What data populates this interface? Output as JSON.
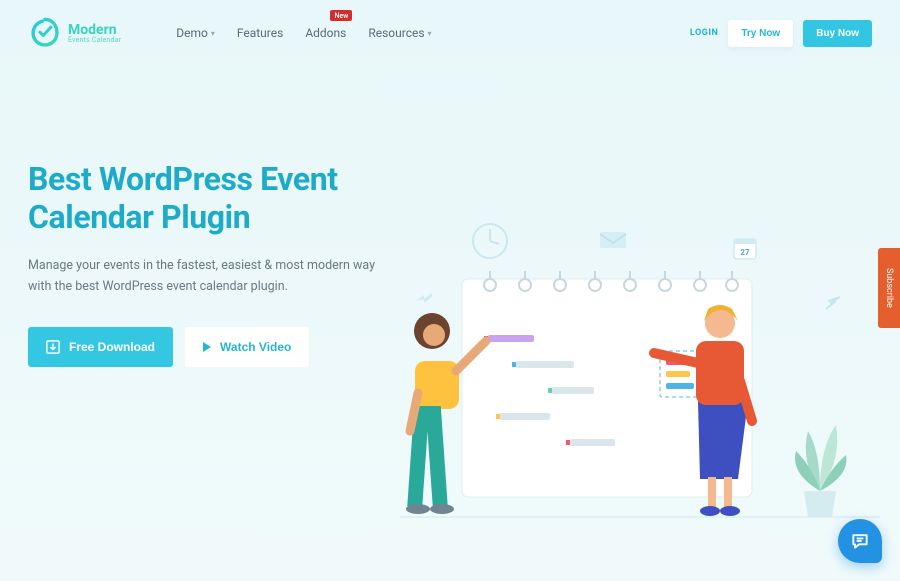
{
  "brand": {
    "name": "Modern",
    "tagline": "Events Calendar"
  },
  "nav": {
    "items": [
      {
        "label": "Demo",
        "hasDropdown": true
      },
      {
        "label": "Features"
      },
      {
        "label": "Addons",
        "badge": "New"
      },
      {
        "label": "Resources",
        "hasDropdown": true
      }
    ]
  },
  "auth": {
    "login": "LOGIN",
    "try": "Try Now",
    "buy": "Buy Now"
  },
  "hero": {
    "title": "Best WordPress Event Calendar Plugin",
    "subtitle": "Manage your events in the fastest, easiest & most modern way with the best WordPress event calendar plugin.",
    "download": "Free Download",
    "watch": "Watch Video"
  },
  "side": {
    "subscribe": "Subscribe"
  },
  "calendar_badge": {
    "day": "27"
  },
  "colors": {
    "teal": "#34c7e2",
    "orange": "#e55f2e",
    "chatBlue": "#2492e2"
  }
}
